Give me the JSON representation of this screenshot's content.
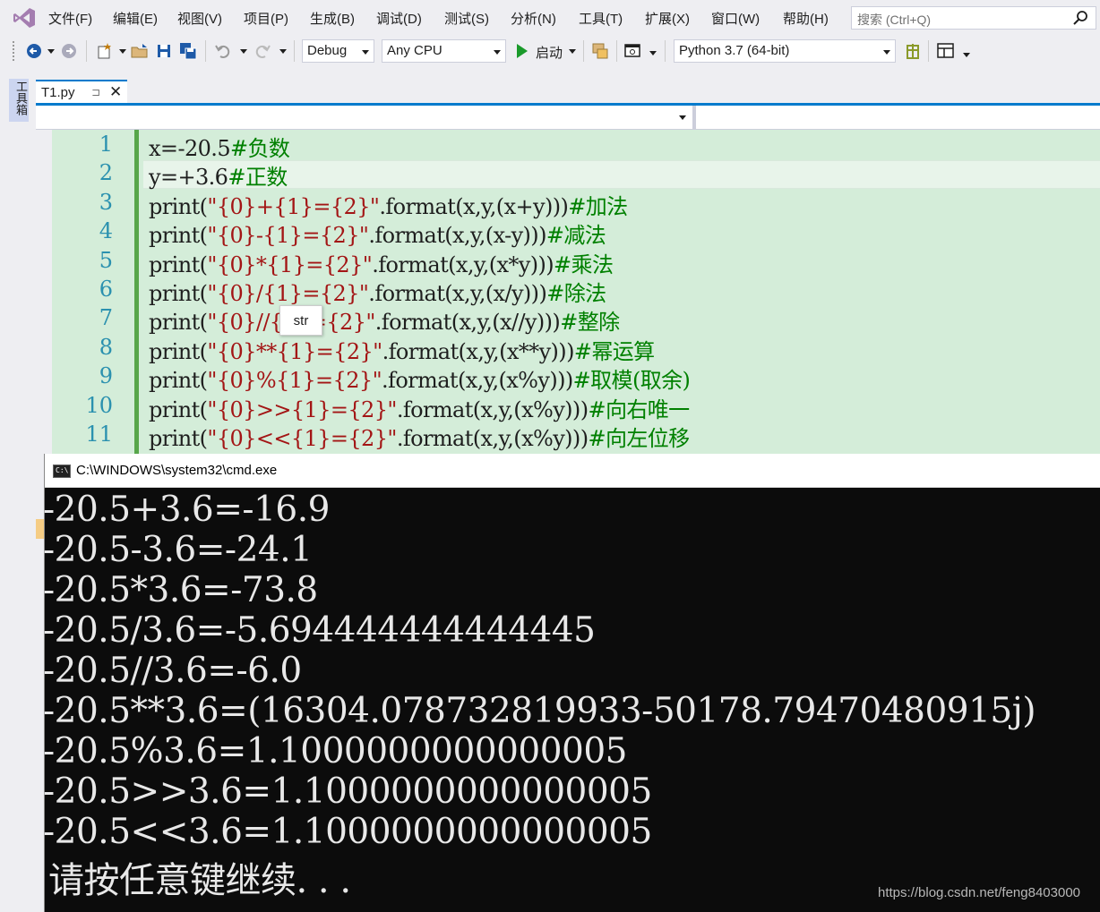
{
  "menu": [
    "文件(F)",
    "编辑(E)",
    "视图(V)",
    "项目(P)",
    "生成(B)",
    "调试(D)",
    "测试(S)",
    "分析(N)",
    "工具(T)",
    "扩展(X)",
    "窗口(W)",
    "帮助(H)"
  ],
  "search": {
    "placeholder": "搜索 (Ctrl+Q)"
  },
  "toolbar": {
    "config": "Debug",
    "platform": "Any CPU",
    "start_label": "启动",
    "environment": "Python 3.7 (64-bit)"
  },
  "side_panel": {
    "toolbox_label": "工具箱"
  },
  "tab": {
    "name": "T1.py",
    "pin": "⊐",
    "close": "✕"
  },
  "editor": {
    "lines": [
      {
        "num": "1",
        "parts": [
          {
            "t": "x=-20.5",
            "c": ""
          },
          {
            "t": "#负数",
            "c": "com"
          }
        ]
      },
      {
        "num": "2",
        "parts": [
          {
            "t": "y=+3.6",
            "c": ""
          },
          {
            "t": "#正数",
            "c": "com"
          }
        ]
      },
      {
        "num": "3",
        "parts": [
          {
            "t": "print(",
            "c": ""
          },
          {
            "t": "\"{0}+{1}={2}\"",
            "c": "str"
          },
          {
            "t": ".format(x,y,(x+y)))",
            "c": ""
          },
          {
            "t": "#加法",
            "c": "com"
          }
        ]
      },
      {
        "num": "4",
        "parts": [
          {
            "t": "print(",
            "c": ""
          },
          {
            "t": "\"{0}-{1}={2}\"",
            "c": "str"
          },
          {
            "t": ".format(x,y,(x-y)))",
            "c": ""
          },
          {
            "t": "#减法",
            "c": "com"
          }
        ]
      },
      {
        "num": "5",
        "parts": [
          {
            "t": "print(",
            "c": ""
          },
          {
            "t": "\"{0}*{1}={2}\"",
            "c": "str"
          },
          {
            "t": ".format(x,y,(x*y)))",
            "c": ""
          },
          {
            "t": "#乘法",
            "c": "com"
          }
        ]
      },
      {
        "num": "6",
        "parts": [
          {
            "t": "print(",
            "c": ""
          },
          {
            "t": "\"{0}/{1}={2}\"",
            "c": "str"
          },
          {
            "t": ".format(x,y,(x/y)))",
            "c": ""
          },
          {
            "t": "#除法",
            "c": "com"
          }
        ]
      },
      {
        "num": "7",
        "parts": [
          {
            "t": "print(",
            "c": ""
          },
          {
            "t": "\"{0}//{1}={2}\"",
            "c": "str"
          },
          {
            "t": ".format(x,y,(x//y)))",
            "c": ""
          },
          {
            "t": "#整除",
            "c": "com"
          }
        ]
      },
      {
        "num": "8",
        "parts": [
          {
            "t": "print(",
            "c": ""
          },
          {
            "t": "\"{0}**{1}={2}\"",
            "c": "str"
          },
          {
            "t": ".format(x,y,(x**y)))",
            "c": ""
          },
          {
            "t": "#幂运算",
            "c": "com"
          }
        ]
      },
      {
        "num": "9",
        "parts": [
          {
            "t": "print(",
            "c": ""
          },
          {
            "t": "\"{0}%{1}={2}\"",
            "c": "str"
          },
          {
            "t": ".format(x,y,(x%y)))",
            "c": ""
          },
          {
            "t": "#取模(取余)",
            "c": "com"
          }
        ]
      },
      {
        "num": "10",
        "parts": [
          {
            "t": "print(",
            "c": ""
          },
          {
            "t": "\"{0}>>{1}={2}\"",
            "c": "str"
          },
          {
            "t": ".format(x,y,(x%y)))",
            "c": ""
          },
          {
            "t": "#向右唯一",
            "c": "com"
          }
        ]
      },
      {
        "num": "11",
        "parts": [
          {
            "t": "print(",
            "c": ""
          },
          {
            "t": "\"{0}<<{1}={2}\"",
            "c": "str"
          },
          {
            "t": ".format(x,y,(x%y)))",
            "c": ""
          },
          {
            "t": "#向左位移",
            "c": "com"
          }
        ]
      }
    ],
    "tooltip": "str"
  },
  "console": {
    "title": "C:\\WINDOWS\\system32\\cmd.exe",
    "icon_text": "C:\\",
    "lines": [
      "-20.5+3.6=-16.9",
      "-20.5-3.6=-24.1",
      "-20.5*3.6=-73.8",
      "-20.5/3.6=-5.694444444444445",
      "-20.5//3.6=-6.0",
      "-20.5**3.6=(16304.078732819933-50178.79470480915j)",
      "-20.5%3.6=1.1000000000000005",
      "-20.5>>3.6=1.1000000000000005",
      "-20.5<<3.6=1.1000000000000005",
      "请按任意键继续. . ."
    ]
  },
  "watermark": "https://blog.csdn.net/feng8403000",
  "colors": {
    "accent": "#007acc",
    "editor_bg": "#d4edd9",
    "string": "#a31515",
    "comment": "#008000",
    "line_number": "#2b91af"
  }
}
